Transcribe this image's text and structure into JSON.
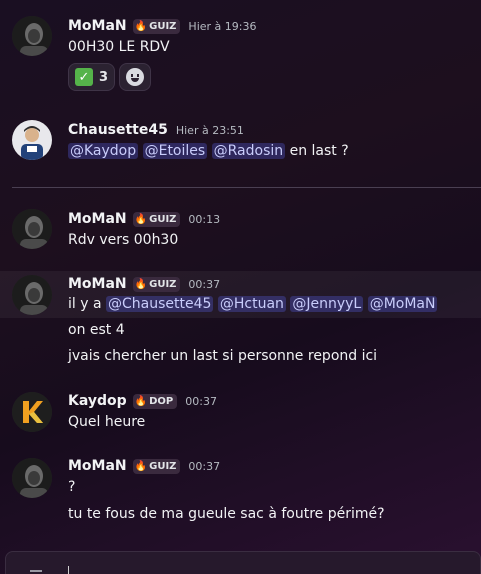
{
  "messages": [
    {
      "author": "MoMaN",
      "tag": "GUIZ",
      "time": "Hier à 19:36",
      "lines": [
        "00H30 LE RDV"
      ],
      "reactions": [
        {
          "emoji": "check-icon",
          "count": "3"
        },
        {
          "emoji": "add-reaction-icon"
        }
      ]
    },
    {
      "author": "Chausette45",
      "time": "Hier à 23:51",
      "mentions": [
        "@Kaydop",
        "@Etoiles",
        "@Radosin"
      ],
      "suffix": "en last ?"
    },
    {
      "author": "MoMaN",
      "tag": "GUIZ",
      "time": "00:13",
      "lines": [
        "Rdv vers 00h30"
      ]
    },
    {
      "author": "MoMaN",
      "tag": "GUIZ",
      "time": "00:37",
      "prefix": "il y a",
      "mentions": [
        "@Chausette45",
        "@Hctuan",
        "@JennyyL",
        "@MoMaN"
      ],
      "lines": [
        "on est 4",
        "jvais chercher un last si personne repond ici"
      ]
    },
    {
      "author": "Kaydop",
      "tag": "DOP",
      "time": "00:37",
      "lines": [
        "Quel heure"
      ]
    },
    {
      "author": "MoMaN",
      "tag": "GUIZ",
      "time": "00:37",
      "lines": [
        "?",
        "tu te fous de ma gueule sac à foutre périmé?"
      ]
    }
  ],
  "colors": {
    "background": "#1a0f22",
    "mention_bg": "#3a3e7a",
    "tag_flame": "#ff7a1a",
    "reaction_check": "#55b34a"
  }
}
